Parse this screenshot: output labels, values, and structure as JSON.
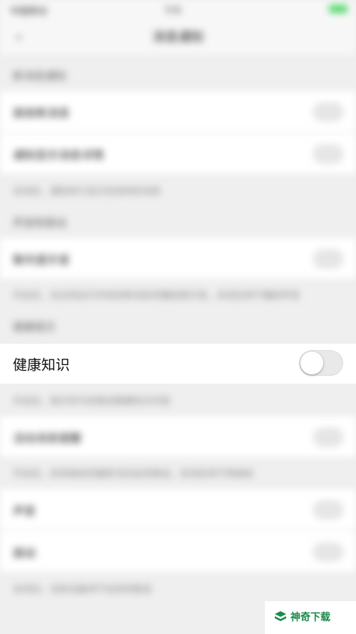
{
  "status_bar": {
    "carrier": "中国移动",
    "time": "下午",
    "battery_icon": "battery-icon"
  },
  "nav": {
    "title": "消息通知",
    "back_icon": "back-arrow-icon"
  },
  "sections": {
    "s1_header": "新消息通知",
    "s1_row1": "接收新消息",
    "s1_row2": "通知显示消息详情",
    "s1_note": "关闭后，通知将只显示您收到的消息",
    "s2_header": "声音和振动",
    "s2_row1": "聊天提示音",
    "s2_note": "开启后，在应用运行时收到新消息将播放提示音，关闭后将不播放声音",
    "s3_header": "健康提示",
    "s3_note": "开启后，每天将为您推送健康知识内容",
    "s4_row1": "活动消息提醒",
    "s4_note": "开启后，您将接收到最新活动信息推送，关闭后将不再接收",
    "s5_row1": "声音",
    "s5_row2": "振动",
    "footer_note": "关闭后，当前设备将不会收到推送"
  },
  "focus_row": {
    "label": "健康知识",
    "toggle_on": false
  },
  "watermark": {
    "text": "神奇下载",
    "icon": "leaf-logo-icon",
    "color": "#1a8c4a"
  }
}
